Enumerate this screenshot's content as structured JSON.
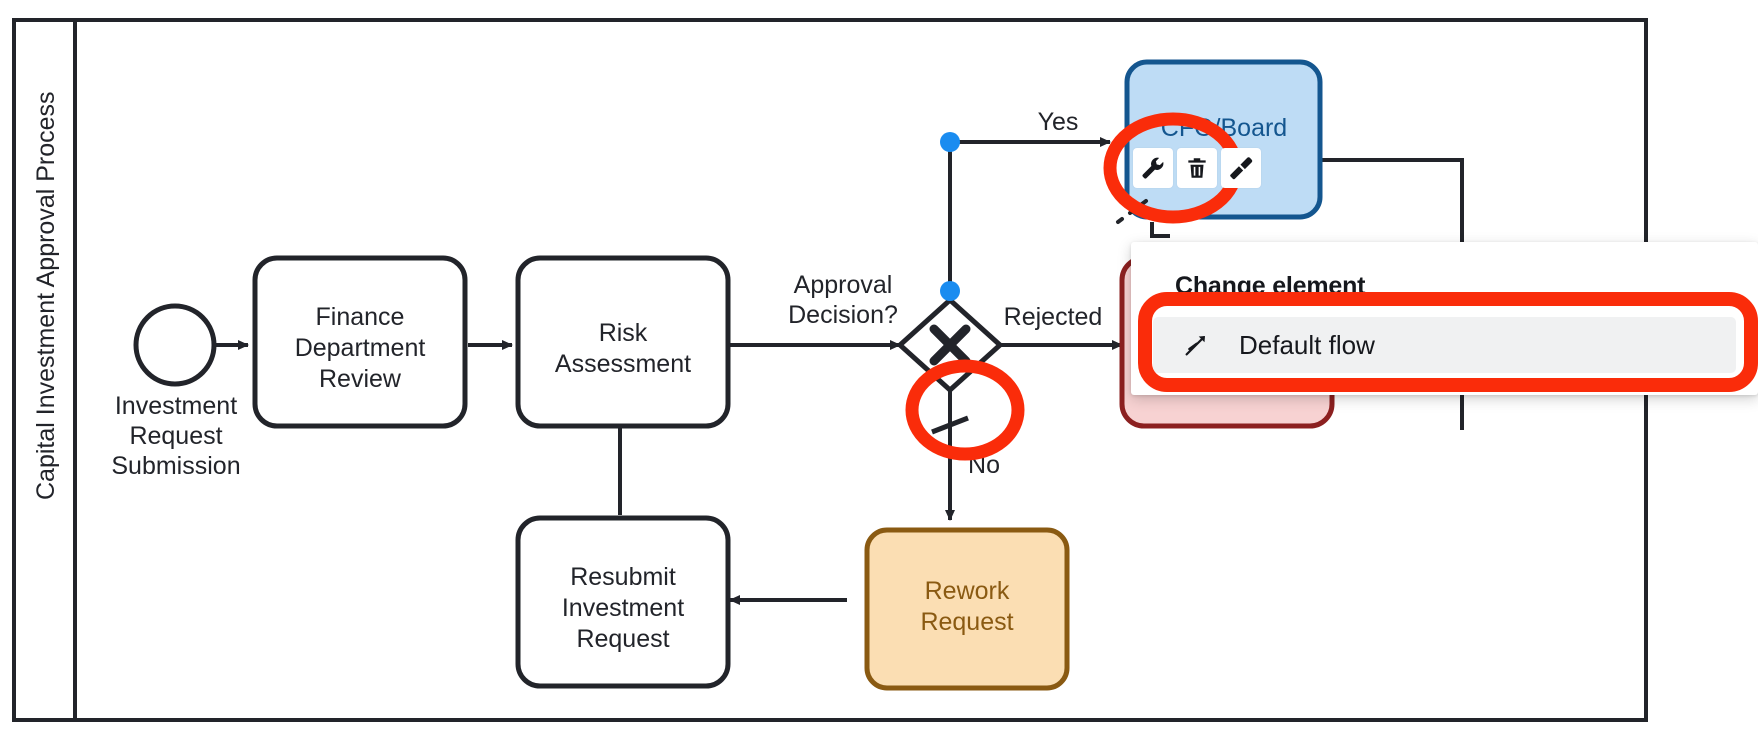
{
  "app": {
    "editor": "bpmn-diagram-editor"
  },
  "pool": {
    "lane_label": "Capital Investment Approval Process"
  },
  "nodes": {
    "start_event": {
      "type": "start-event",
      "label": "Investment Request Submission",
      "label_lines": [
        "Investment",
        "Request",
        "Submission"
      ]
    },
    "task_finance": {
      "type": "task",
      "label": "Finance Department Review",
      "label_lines": [
        "Finance",
        "Department",
        "Review"
      ]
    },
    "task_risk": {
      "type": "task",
      "label": "Risk Assessment",
      "label_lines": [
        "Risk",
        "Assessment"
      ]
    },
    "gateway_approval": {
      "type": "exclusive-gateway",
      "label": "Approval Decision?",
      "label_lines": [
        "Approval",
        "Decision?"
      ],
      "marker": "X"
    },
    "task_cfo": {
      "type": "task",
      "label": "CFO/Board",
      "state": "selected",
      "fill": "#bedcf5",
      "stroke": "#14568f",
      "text_color": "#14568f"
    },
    "task_rejected": {
      "type": "task",
      "label": "",
      "state": "hover-highlight",
      "fill": "#f7d2d2",
      "stroke": "#8c2020"
    },
    "task_resubmit": {
      "type": "task",
      "label": "Resubmit Investment Request",
      "label_lines": [
        "Resubmit",
        "Investment",
        "Request"
      ]
    },
    "task_rework": {
      "type": "task",
      "label": "Rework Request",
      "label_lines": [
        "Rework",
        "Request"
      ],
      "fill": "#fbdeb3",
      "stroke": "#8a5a12",
      "text_color": "#8a5a12"
    }
  },
  "flows": {
    "yes_label": "Yes",
    "no_label": "No",
    "rejected_label": "Rejected"
  },
  "context_pad": {
    "items": [
      {
        "name": "wrench-icon",
        "title": "Change element",
        "highlighted": true
      },
      {
        "name": "trash-icon",
        "title": "Remove"
      },
      {
        "name": "brush-icon",
        "title": "Set color"
      }
    ]
  },
  "popup": {
    "title": "Change element",
    "entries": [
      {
        "icon": "default-flow-icon",
        "label": "Default flow",
        "selected": true
      }
    ]
  },
  "annotations": {
    "highlight_color": "#fa2c0a",
    "circles": [
      {
        "name": "wrench-tool-highlight",
        "target": "wrench-icon"
      },
      {
        "name": "default-flow-marker-highlight",
        "target": "gateway-default-flow-marker"
      }
    ],
    "rounded_box": {
      "name": "default-flow-entry-highlight",
      "target": "popup-entry-default-flow"
    }
  },
  "colors": {
    "stroke": "#22242a",
    "accent_red": "#fa2c0a",
    "connection_dot": "#1a8cf0",
    "selected_fill": "#bedcf5",
    "selected_stroke": "#14568f",
    "rework_fill": "#fbdeb3",
    "rework_stroke": "#8a5a12",
    "rejected_fill": "#f7d2d2",
    "rejected_stroke": "#8c2020"
  }
}
